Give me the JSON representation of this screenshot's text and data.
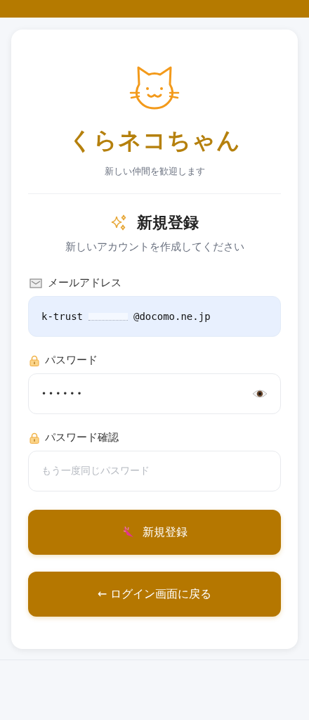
{
  "app": {
    "title": "くらネコちゃん",
    "tagline": "新しい仲間を歓迎します"
  },
  "form": {
    "heading": "新規登録",
    "subheading": "新しいアカウントを作成してください",
    "fields": [
      {
        "kind": "email",
        "label": "メールアドレス",
        "value_start": "k-trust",
        "value_end": "@docomo.ne.jp",
        "autofilled": true
      },
      {
        "kind": "password",
        "label": "パスワード",
        "value": "••••••",
        "autofilled": false
      },
      {
        "kind": "password-confirm",
        "label": "パスワード確認",
        "placeholder": "もう一度同じパスワード",
        "autofilled": false
      }
    ],
    "buttons": [
      {
        "kind": "submit",
        "label": "新規登録"
      },
      {
        "kind": "back",
        "arrow": "←",
        "label": "ログイン画面に戻る"
      }
    ]
  }
}
